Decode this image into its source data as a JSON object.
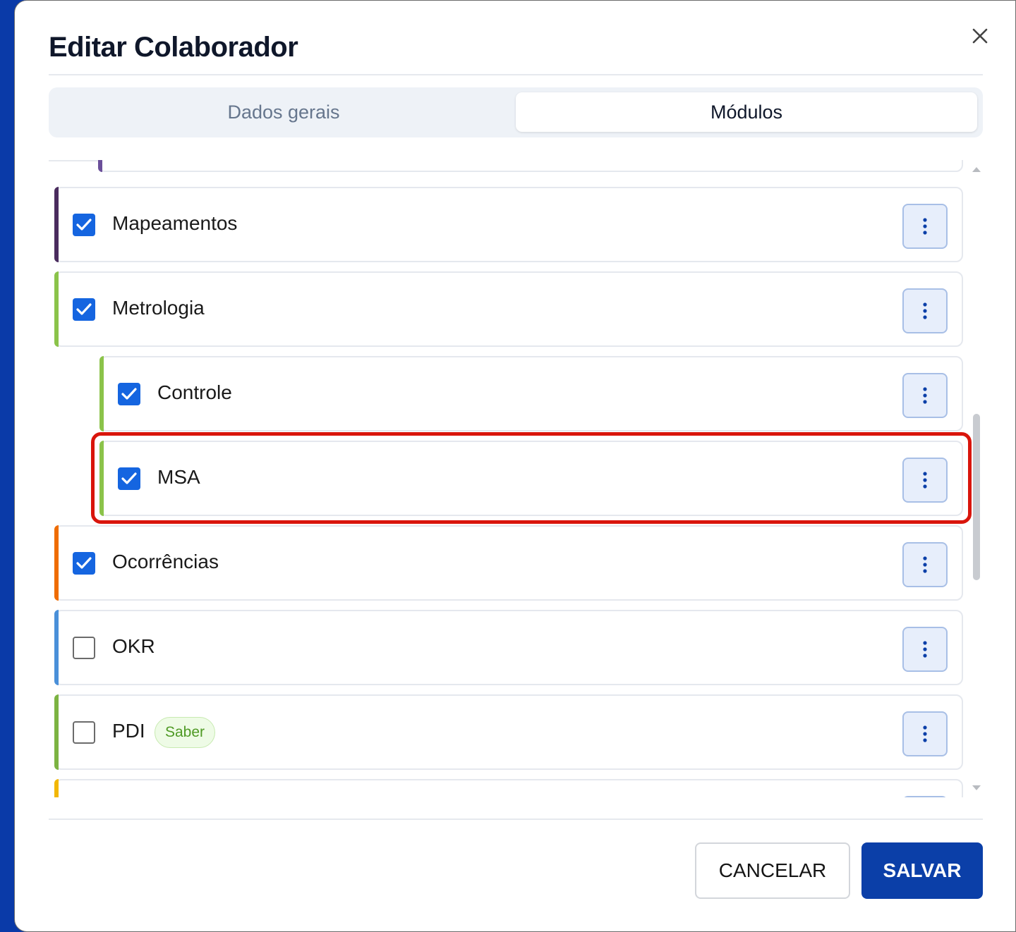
{
  "modal": {
    "title": "Editar Colaborador",
    "close_icon": "close-icon"
  },
  "tabs": [
    {
      "label": "Dados gerais",
      "active": false
    },
    {
      "label": "Módulos",
      "active": true
    }
  ],
  "modules": [
    {
      "label": "Mapeamentos",
      "checked": true,
      "color": "#4a2c5e",
      "level": 0
    },
    {
      "label": "Metrologia",
      "checked": true,
      "color": "#8bc34a",
      "level": 0
    },
    {
      "label": "Controle",
      "checked": true,
      "color": "#8bc34a",
      "level": 1
    },
    {
      "label": "MSA",
      "checked": true,
      "color": "#8bc34a",
      "level": 1,
      "highlighted": true
    },
    {
      "label": "Ocorrências",
      "checked": true,
      "color": "#ef6c00",
      "level": 0
    },
    {
      "label": "OKR",
      "checked": false,
      "color": "#4a90d9",
      "level": 0
    },
    {
      "label": "PDI",
      "checked": false,
      "color": "#7cb342",
      "level": 0,
      "badge": "Saber"
    }
  ],
  "colors": {
    "accent": "#1565e0",
    "primary_button": "#0b3fa8",
    "highlight": "#d9150c",
    "partial_top_card_bar": "#6b4f9a",
    "partial_bottom_card_bar": "#f2b705"
  },
  "footer": {
    "cancel_label": "CANCELAR",
    "save_label": "SALVAR"
  }
}
